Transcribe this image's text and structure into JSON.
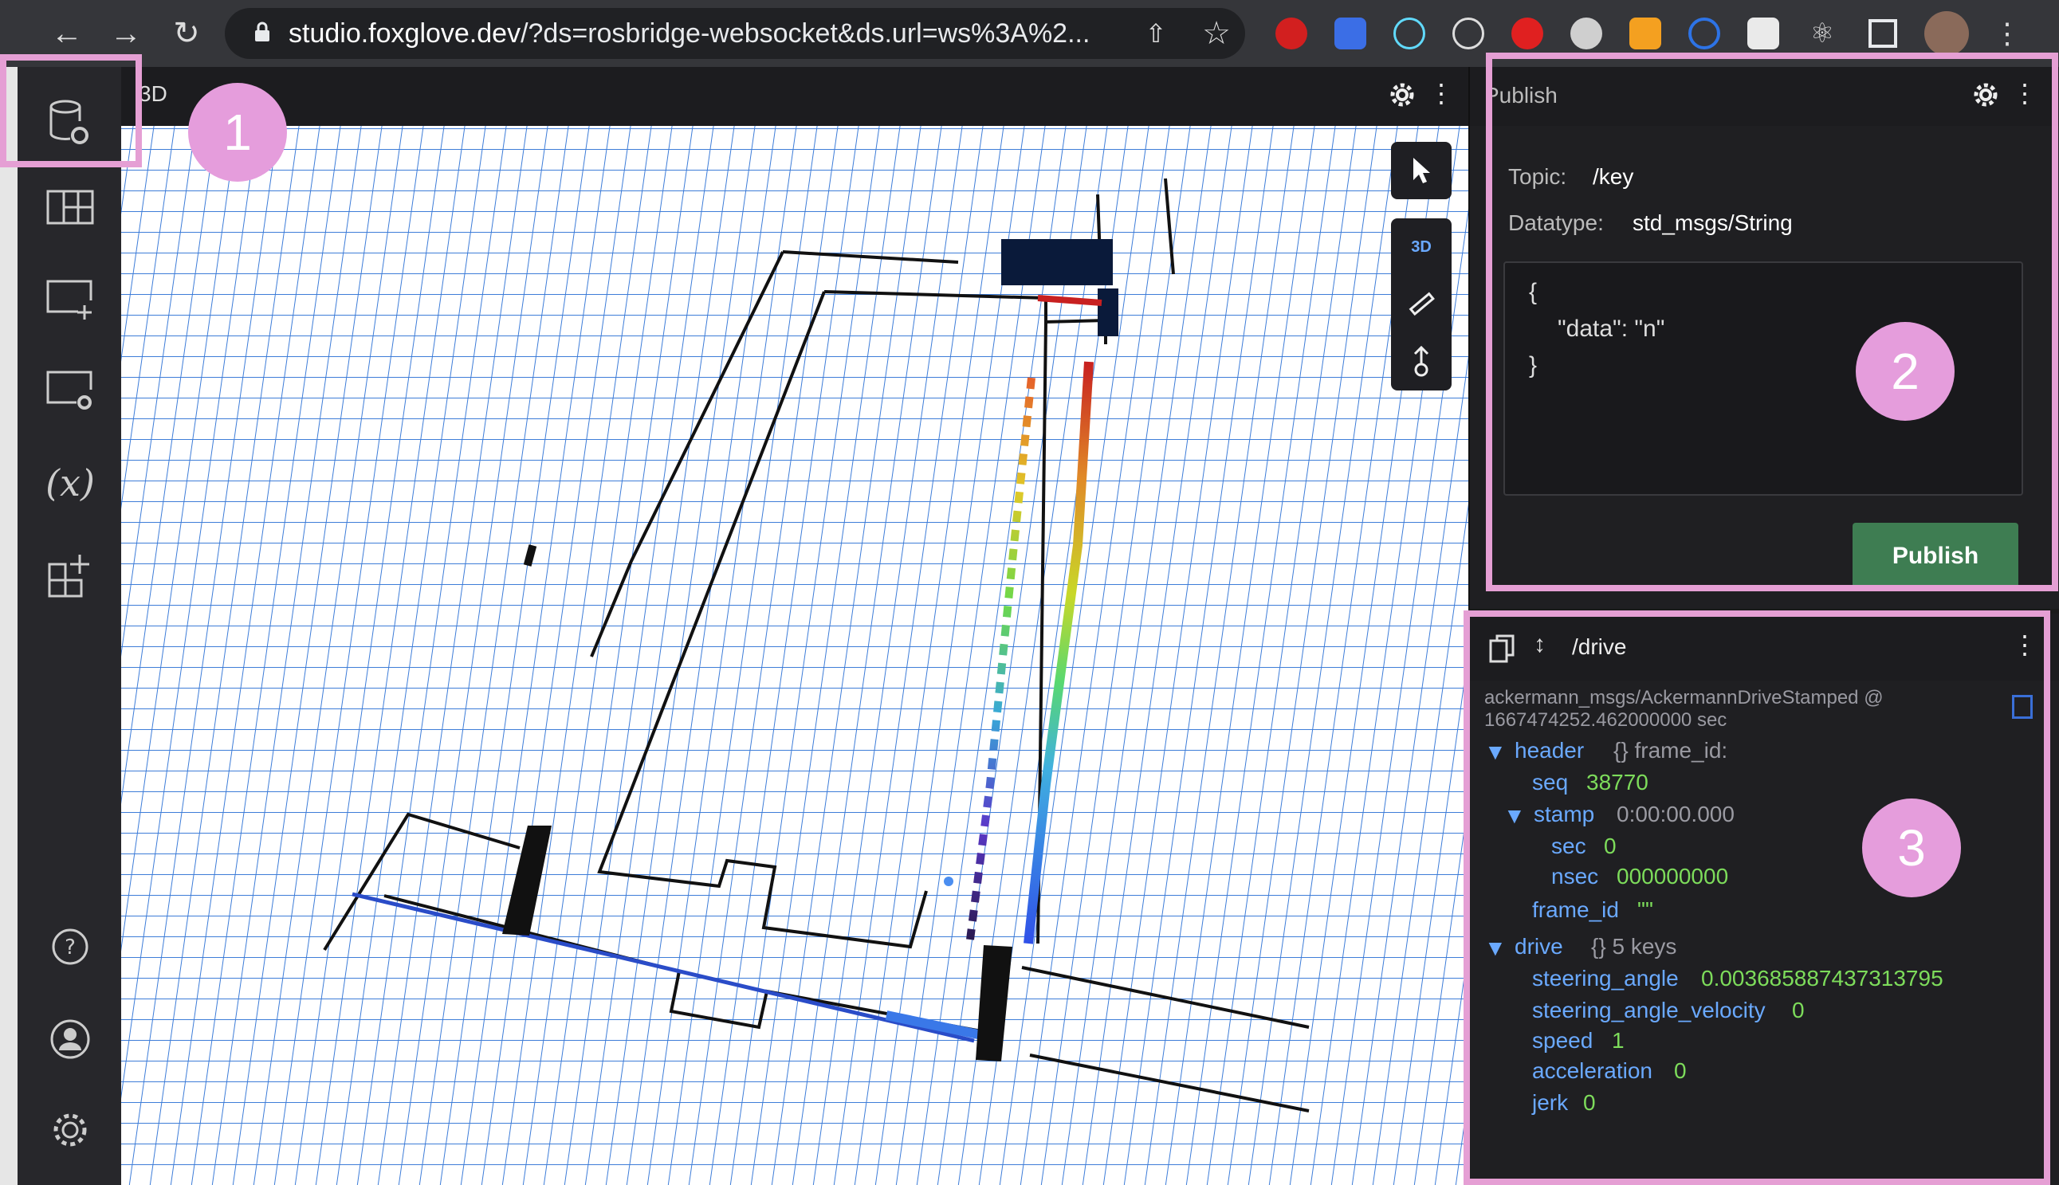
{
  "browser": {
    "url_host": "studio.foxglove.dev",
    "url_path": "/?ds=rosbridge-websocket&ds.url=ws%3A%2..."
  },
  "panel_3d": {
    "title": "3D",
    "toolbar_mode_label": "3D"
  },
  "publish_panel": {
    "title": "Publish",
    "topic_label": "Topic:",
    "topic_value": "/key",
    "datatype_label": "Datatype:",
    "datatype_value": "std_msgs/String",
    "editor_line1": "{",
    "editor_line2": "\"data\": \"n\"",
    "editor_line3": "}",
    "publish_button": "Publish"
  },
  "raw_messages": {
    "topic": "/drive",
    "schema_line1": "ackermann_msgs/AckermannDriveStamped @",
    "schema_line2": "1667474252.462000000 sec",
    "header_key": "header",
    "header_summary": "{} frame_id:",
    "seq_key": "seq",
    "seq_val": "38770",
    "stamp_key": "stamp",
    "stamp_val": "0:00:00.000",
    "sec_key": "sec",
    "sec_val": "0",
    "nsec_key": "nsec",
    "nsec_val": "000000000",
    "frame_id_key": "frame_id",
    "frame_id_val": "\"\"",
    "drive_key": "drive",
    "drive_summary": "{} 5 keys",
    "steering_angle_key": "steering_angle",
    "steering_angle_val": "0.003685887437313795",
    "steering_angle_velocity_key": "steering_angle_velocity",
    "steering_angle_velocity_val": "0",
    "speed_key": "speed",
    "speed_val": "1",
    "acceleration_key": "acceleration",
    "acceleration_val": "0",
    "jerk_key": "jerk",
    "jerk_val": "0"
  },
  "annotations": {
    "badge1": "1",
    "badge2": "2",
    "badge3": "3"
  },
  "colors": {
    "annotation": "#e59ddc",
    "publish_button": "#3e7d52",
    "json_key": "#6aa9ff",
    "json_number": "#7ddc5b"
  }
}
